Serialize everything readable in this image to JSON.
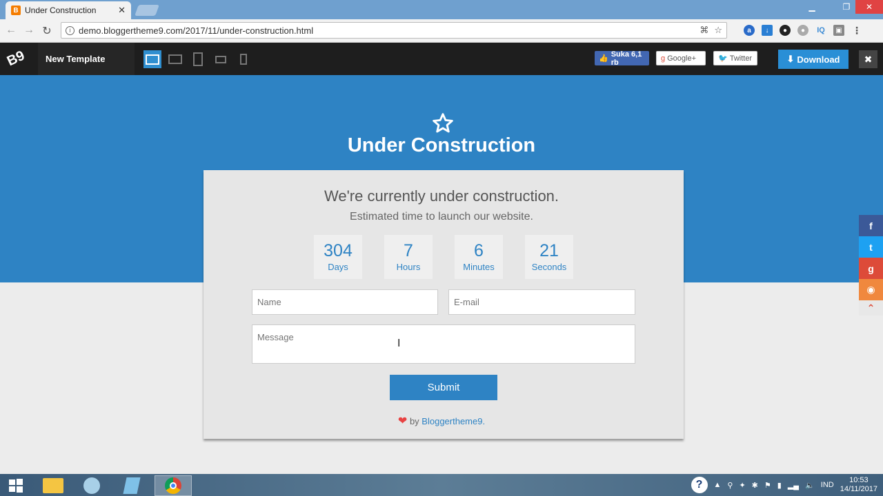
{
  "browser": {
    "tab_title": "Under Construction",
    "url": "demo.bloggertheme9.com/2017/11/under-construction.html"
  },
  "template_bar": {
    "logo_text": "B9",
    "name": "New Template",
    "facebook_label": "Suka 6,1 rb",
    "google_label": "Google+",
    "twitter_label": "Twitter",
    "download_label": "Download"
  },
  "page": {
    "title": "Under Construction",
    "headline": "We're currently under construction.",
    "subheadline": "Estimated time to launch our website.",
    "countdown": [
      {
        "value": "304",
        "label": "Days"
      },
      {
        "value": "7",
        "label": "Hours"
      },
      {
        "value": "6",
        "label": "Minutes"
      },
      {
        "value": "21",
        "label": "Seconds"
      }
    ],
    "form": {
      "name_placeholder": "Name",
      "email_placeholder": "E-mail",
      "message_placeholder": "Message",
      "submit_label": "Submit"
    },
    "credit_by": "by",
    "credit_link": "Bloggertheme9."
  },
  "taskbar": {
    "language": "IND",
    "time": "10:53",
    "date": "14/11/2017"
  },
  "colors": {
    "accent": "#2e83c4",
    "facebook": "#3b5998",
    "twitter": "#1da1f2",
    "google": "#dd4b39",
    "rss": "#f0883e",
    "top": "#e8e8e8"
  }
}
